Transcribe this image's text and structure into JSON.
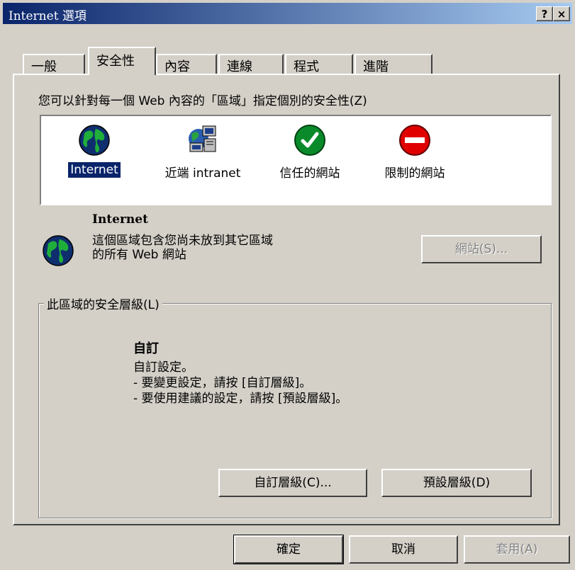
{
  "window": {
    "title": "Internet 選項"
  },
  "titlebar": {
    "help_label": "?",
    "close_label": "×"
  },
  "tabs": [
    {
      "label": "一般"
    },
    {
      "label": "安全性"
    },
    {
      "label": "內容"
    },
    {
      "label": "連線"
    },
    {
      "label": "程式"
    },
    {
      "label": "進階"
    }
  ],
  "security": {
    "description": "您可以針對每一個 Web 內容的「區域」指定個別的安全性(Z)",
    "zones": [
      {
        "label": "Internet",
        "icon": "globe-icon",
        "selected": true
      },
      {
        "label": "近端 intranet",
        "icon": "network-computers-icon",
        "selected": false
      },
      {
        "label": "信任的網站",
        "icon": "green-check-icon",
        "selected": false
      },
      {
        "label": "限制的網站",
        "icon": "red-no-entry-icon",
        "selected": false
      }
    ],
    "selected_zone": {
      "title": "Internet",
      "desc_line1": "這個區域包含您尚未放到其它區域",
      "desc_line2": "的所有 Web 網站",
      "sites_button": "網站(S)..."
    },
    "level_group": {
      "title": "此區域的安全層級(L)",
      "level_name": "自訂",
      "lines": [
        "自訂設定。",
        "- 要變更設定，請按 [自訂層級]。",
        "- 要使用建議的設定，請按 [預設層級]。"
      ],
      "custom_button": "自訂層級(C)...",
      "default_button": "預設層級(D)"
    }
  },
  "footer": {
    "ok": "確定",
    "cancel": "取消",
    "apply": "套用(A)"
  },
  "colors": {
    "dialog_bg": "#d4d0c8",
    "titlebar_start": "#0a246a",
    "titlebar_end": "#a6caf0",
    "selection": "#0a246a"
  }
}
